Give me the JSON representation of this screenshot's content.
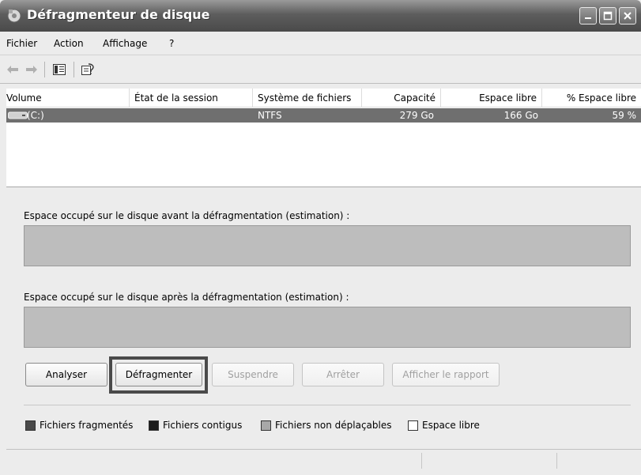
{
  "window": {
    "title": "Défragmenteur de disque"
  },
  "menu": {
    "items": [
      "Fichier",
      "Action",
      "Affichage",
      "?"
    ]
  },
  "toolbar": {
    "icons": [
      "back-arrow-icon",
      "forward-arrow-icon",
      "show-hide-console-tree-icon",
      "properties-icon"
    ]
  },
  "volumes": {
    "headers": [
      "Volume",
      "État de la session",
      "Système de fichiers",
      "Capacité",
      "Espace libre",
      "% Espace libre"
    ],
    "rows": [
      {
        "volume": "(C:)",
        "state": "",
        "filesystem": "NTFS",
        "capacity": "279 Go",
        "free": "166 Go",
        "percent_free": "59 %"
      }
    ]
  },
  "labels": {
    "before": "Espace occupé sur le disque avant la défragmentation (estimation) :",
    "after": "Espace occupé sur le disque après la défragmentation (estimation) :"
  },
  "buttons": {
    "analyze": "Analyser",
    "defragment": "Défragmenter",
    "pause": "Suspendre",
    "stop": "Arrêter",
    "report": "Afficher le rapport"
  },
  "legend": [
    {
      "label": "Fichiers fragmentés",
      "color": "#4a4a4a"
    },
    {
      "label": "Fichiers contigus",
      "color": "#1c1c1c"
    },
    {
      "label": "Fichiers non déplaçables",
      "color": "#a8a8a8"
    },
    {
      "label": "Espace libre",
      "color": "#ffffff"
    }
  ],
  "colors": {
    "titlebar": "#5d5d5d",
    "selection": "#6f6f6f",
    "bar": "#bdbdbd"
  }
}
